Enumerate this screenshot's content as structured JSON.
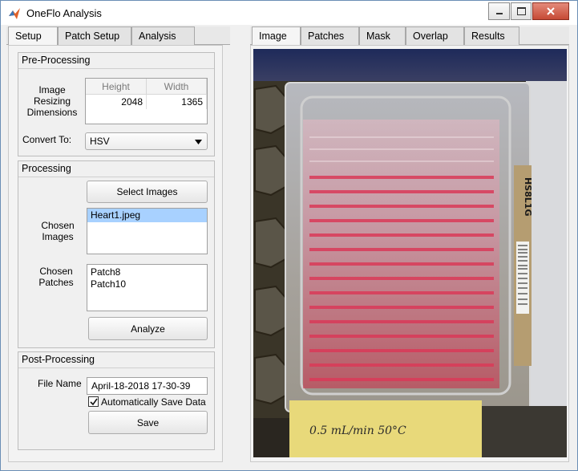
{
  "window": {
    "title": "OneFlo Analysis"
  },
  "icons": {
    "app": "matlab-logo-icon",
    "minimize": "minimize-icon",
    "maximize": "maximize-icon",
    "close": "close-icon",
    "dropdown": "chevron-down-icon",
    "check": "checkmark-icon"
  },
  "left_tabs": [
    "Setup",
    "Patch Setup",
    "Analysis"
  ],
  "left_active_tab": "Setup",
  "right_tabs": [
    "Image",
    "Patches",
    "Mask",
    "Overlap",
    "Results"
  ],
  "right_active_tab": "Image",
  "preprocessing": {
    "title": "Pre-Processing",
    "resize_label": "Image\nResizing\nDimensions",
    "columns": [
      "Height",
      "Width"
    ],
    "height_value": "2048",
    "width_value": "1365",
    "convert_label": "Convert To:",
    "convert_value": "HSV"
  },
  "processing": {
    "title": "Processing",
    "select_images_label": "Select Images",
    "chosen_images_label": "Chosen\nImages",
    "chosen_images": [
      "Heart1.jpeg"
    ],
    "chosen_patches_label": "Chosen\nPatches",
    "chosen_patches": [
      "Patch8",
      "Patch10"
    ],
    "analyze_label": "Analyze"
  },
  "postprocessing": {
    "title": "Post-Processing",
    "filename_label": "File Name",
    "filename_value": "April-18-2018 17-30-39",
    "autosave_label": "Automatically Save Data",
    "autosave_checked": true,
    "save_label": "Save"
  },
  "photo": {
    "description_icon": "microfluidic-chip-photo",
    "chip_label": "HS8L1G",
    "note_text": "0.5 mL/min 50°C"
  },
  "colors": {
    "window_bg": "#f0f0f0",
    "selection": "#a8d1ff",
    "close_button": "#c64a35",
    "fluid": "#d23a55"
  }
}
